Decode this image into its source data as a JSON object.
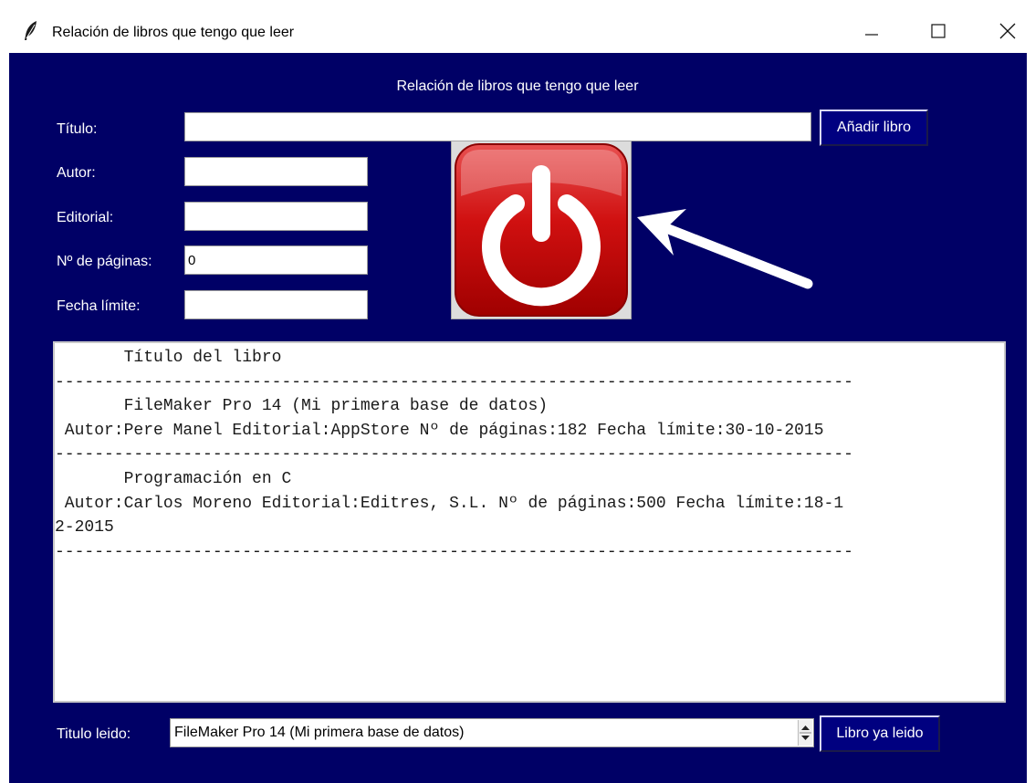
{
  "window": {
    "title": "Relación de libros que tengo que leer",
    "icon": "feather-icon",
    "controls": [
      "minimize-icon",
      "maximize-icon",
      "close-icon"
    ]
  },
  "app": {
    "heading": "Relación de libros que tengo que leer"
  },
  "form": {
    "titulo_label": "Título:",
    "titulo_value": "",
    "autor_label": "Autor:",
    "autor_value": "",
    "editorial_label": "Editorial:",
    "editorial_value": "",
    "paginas_label": "Nº de páginas:",
    "paginas_value": "0",
    "fecha_label": "Fecha límite:",
    "fecha_value": "",
    "add_button": "Añadir libro"
  },
  "power_button": {
    "icon": "power-icon",
    "color": "#d40f0f"
  },
  "annotation_arrow": {
    "icon": "arrow-icon",
    "color": "#ffffff"
  },
  "book_list": {
    "lines": [
      "       Título del libro",
      "---------------------------------------------------------------------------------",
      "       FileMaker Pro 14 (Mi primera base de datos)",
      " Autor:Pere Manel Editorial:AppStore Nº de páginas:182 Fecha límite:30-10-2015",
      "---------------------------------------------------------------------------------",
      "       Programación en C",
      " Autor:Carlos Moreno Editorial:Editres, S.L. Nº de páginas:500 Fecha límite:18-1",
      "2-2015",
      "---------------------------------------------------------------------------------"
    ]
  },
  "footer": {
    "leido_label": "Titulo leido:",
    "selected_title": "FileMaker Pro 14 (Mi primera base de datos)",
    "mark_read_button": "Libro ya leido"
  },
  "colors": {
    "background": "#000066",
    "button": "#000080",
    "text": "#ffffff"
  }
}
